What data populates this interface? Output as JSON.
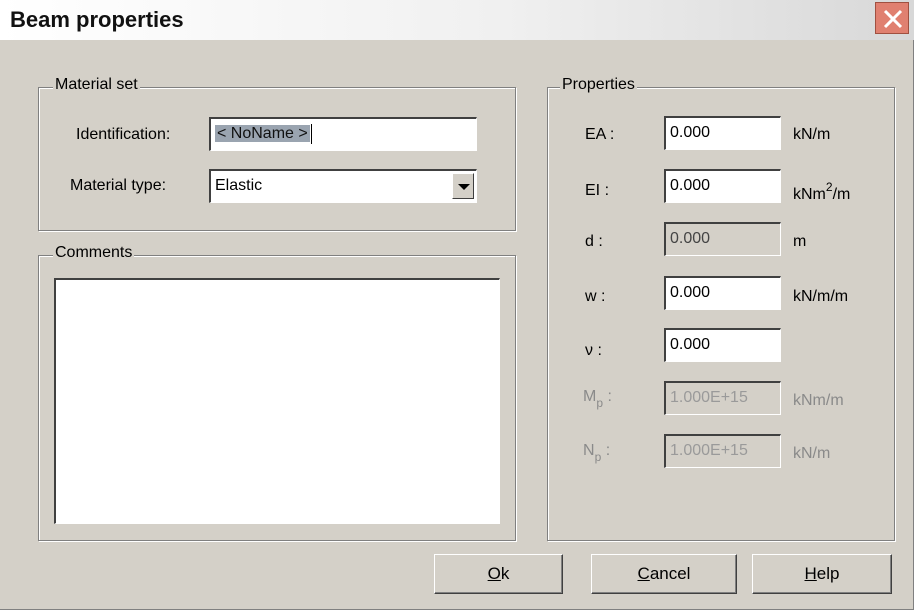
{
  "window": {
    "title": "Beam properties"
  },
  "material_set": {
    "legend": "Material set",
    "identification_label": "Identification:",
    "identification_value": "< NoName >",
    "material_type_label": "Material type:",
    "material_type_value": "Elastic"
  },
  "comments": {
    "legend": "Comments"
  },
  "properties": {
    "legend": "Properties",
    "rows": [
      {
        "label": "EA :",
        "value": "0.000",
        "unit": "kN/m"
      },
      {
        "label": "EI :",
        "value": "0.000",
        "unit_base": "kNm",
        "unit_sup": "2",
        "unit_tail": "/m"
      },
      {
        "label": "d :",
        "value": "0.000",
        "unit": "m"
      },
      {
        "label": "w :",
        "value": "0.000",
        "unit": "kN/m/m"
      },
      {
        "label": "ν :",
        "value": "0.000",
        "unit": ""
      },
      {
        "label_base": "M",
        "label_sub": "p",
        "label_tail": " :",
        "value": "1.000E+15",
        "unit": "kNm/m"
      },
      {
        "label_base": "N",
        "label_sub": "p",
        "label_tail": " :",
        "value": "1.000E+15",
        "unit": "kN/m"
      }
    ]
  },
  "buttons": {
    "ok": {
      "accel": "O",
      "rest": "k"
    },
    "cancel": {
      "accel": "C",
      "rest": "ancel"
    },
    "help": {
      "accel": "H",
      "rest": "elp"
    }
  },
  "colors": {
    "dialog_bg": "#d4d0c8",
    "close_button": "#e08070"
  }
}
